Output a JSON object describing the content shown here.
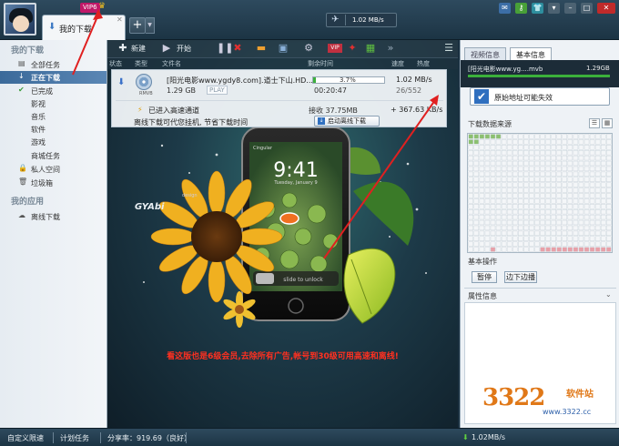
{
  "header": {
    "vip_badge": "VIP6",
    "tab_label": "我的下载",
    "speed_value": "1.02 MB/s"
  },
  "sidebar": {
    "section_downloads": "我的下载",
    "items": [
      {
        "label": "全部任务"
      },
      {
        "label": "正在下载"
      },
      {
        "label": "已完成"
      },
      {
        "label": "影视"
      },
      {
        "label": "音乐"
      },
      {
        "label": "软件"
      },
      {
        "label": "游戏"
      },
      {
        "label": "商城任务"
      },
      {
        "label": "私人空间"
      },
      {
        "label": "垃圾箱"
      }
    ],
    "section_apps": "我的应用",
    "app_items": [
      {
        "label": "离线下载"
      }
    ]
  },
  "toolbar": {
    "new_label": "新建",
    "start_label": "开始"
  },
  "columns": [
    "状态",
    "类型",
    "文件名",
    "剩余时间",
    "速度",
    "热度"
  ],
  "task": {
    "name": "[阳光电影www.ygdy8.com].道士下山.HD...",
    "size": "1.29 GB",
    "play": "PLAY",
    "progress_text": "3.7%",
    "progress_value": 0.037,
    "elapsed": "00:20:47",
    "speed": "1.02 MB/s",
    "pieces": "26/552",
    "type_tag": "RMVB",
    "highspeed": "已进入高速通道",
    "received": "接收 37.75MB",
    "recv_speed": "+ 367.63 KB/s",
    "offline_hint": "离线下载可代您挂机, 节省下载时间",
    "offline_button": "启动离线下载"
  },
  "ad": {
    "text": "看这版也是6级会员,去除所有广告,帐号到30级可用高速和离线!",
    "phone_time": "9:41",
    "phone_date": "Tuesday, January 9",
    "phone_carrier": "Cingular",
    "slide_text": "slide to unlock",
    "logo": "GYAbi",
    "logo_sub": "design"
  },
  "right_panel": {
    "tab_video": "视频信息",
    "tab_basic": "基本信息",
    "file_name": "[阳光电影www.yg....mvb",
    "file_size": "1.29GB",
    "source_check": "原始地址可能失效",
    "source_head": "下载数据来源",
    "ops_head": "基本操作",
    "pause_btn": "暂停",
    "playwhile_btn": "边下边播",
    "attr_head": "属性信息"
  },
  "status": {
    "custom_limit": "自定义限速",
    "scheduled": "计划任务",
    "share_rate": "分享率：919.69（良好）",
    "dl_speed": "1.02MB/s"
  },
  "watermark": {
    "num": "3322",
    "site": "软件站",
    "domain": "www.3322.cc"
  },
  "colors": {
    "accent": "#3b6a9a",
    "progress": "#3bb03b",
    "ad_text": "#ff3020",
    "arrow": "#e02020"
  }
}
